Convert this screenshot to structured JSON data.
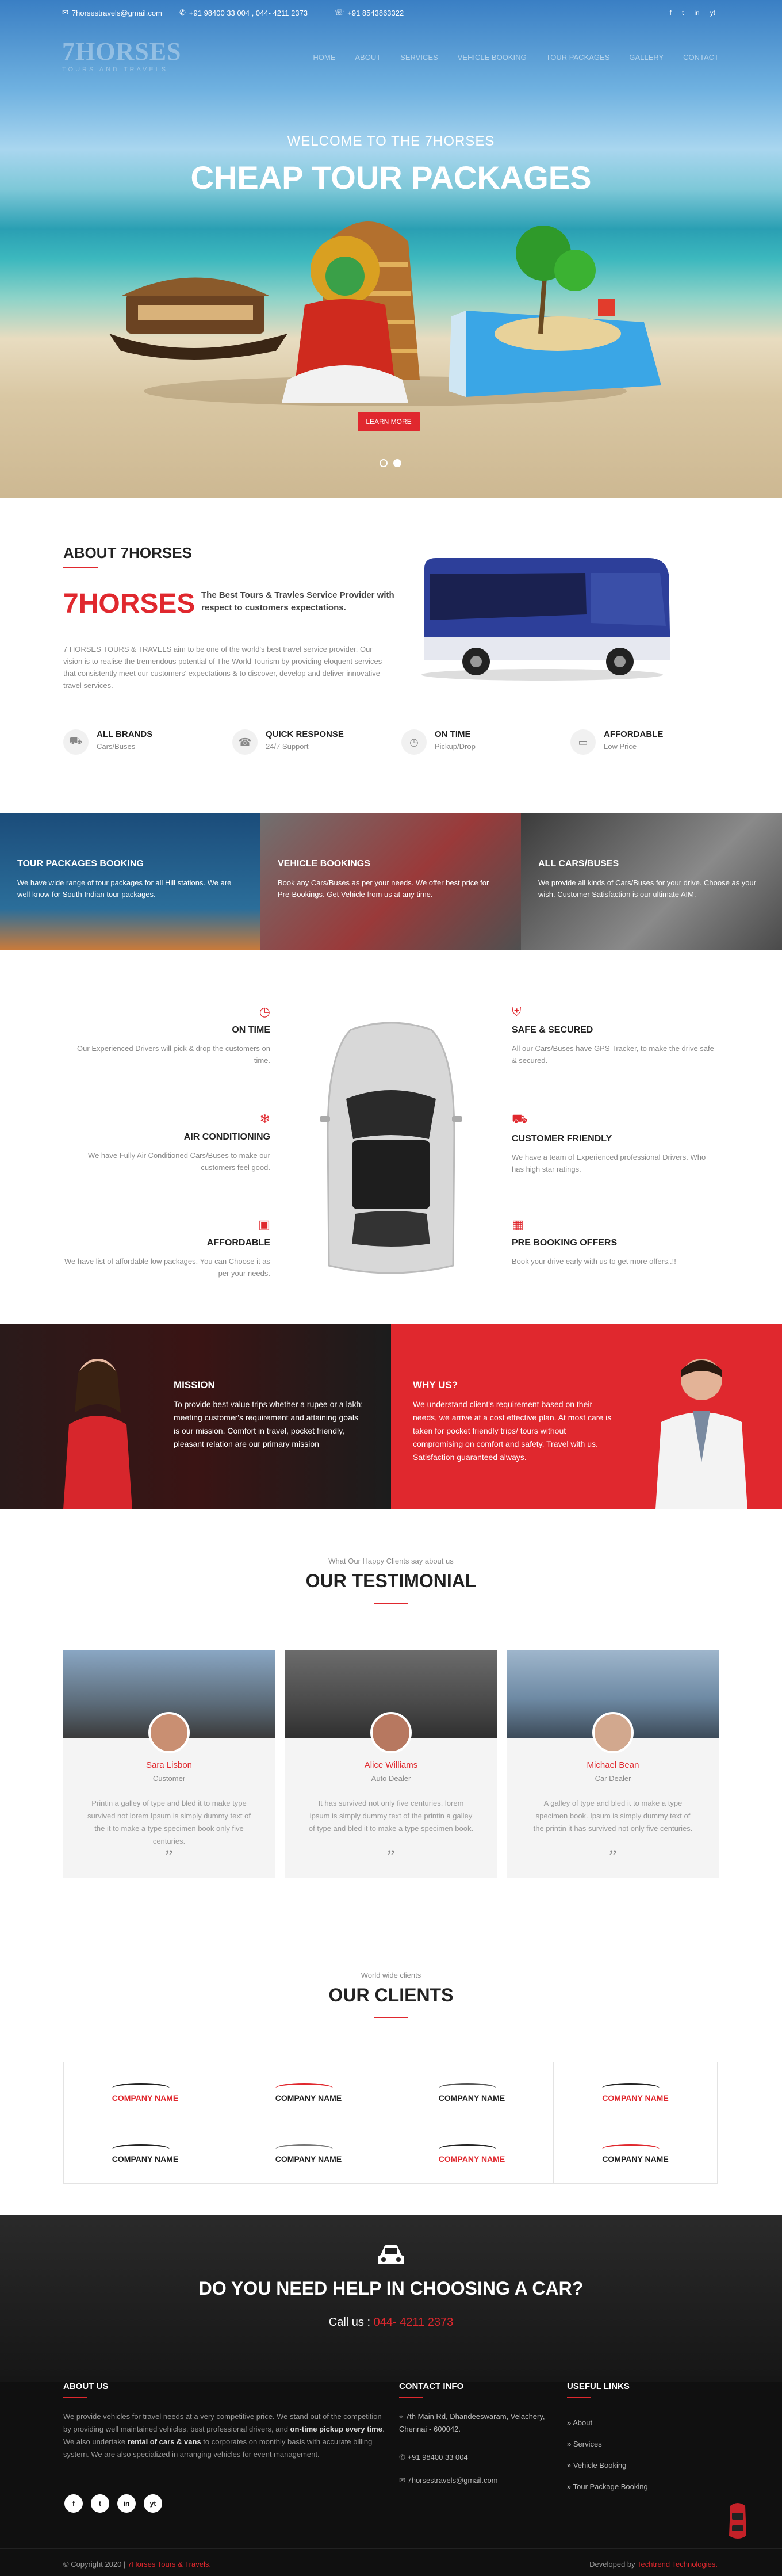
{
  "topbar": {
    "email": "7horsestravels@gmail.com",
    "phones": "+91 98400 33 004 , 044- 4211 2373",
    "mobile": "+91 8543863322",
    "social": [
      "f",
      "t",
      "in",
      "yt"
    ]
  },
  "logo": {
    "name": "7HORSES",
    "tagline": "TOURS AND TRAVELS"
  },
  "nav": [
    "HOME",
    "ABOUT",
    "SERVICES",
    "VEHICLE BOOKING",
    "TOUR PACKAGES",
    "GALLERY",
    "CONTACT"
  ],
  "hero": {
    "welcome": "WELCOME TO THE 7HORSES",
    "title": "CHEAP TOUR PACKAGES",
    "button": "LEARN MORE"
  },
  "about": {
    "heading": "ABOUT 7HORSES",
    "brand": "7HORSES",
    "tagline": "The Best Tours & Travles Service Provider with respect to customers expectations.",
    "body": "7 HORSES TOURS & TRAVELS aim to be one of the world's best travel service provider. Our vision is to realise the tremendous potential of The World Tourism by providing eloquent services that consistently meet our customers' expectations & to discover, develop and deliver innovative travel services.",
    "features": [
      {
        "title": "ALL BRANDS",
        "sub": "Cars/Buses",
        "icon": "car-icon"
      },
      {
        "title": "QUICK RESPONSE",
        "sub": "24/7 Support",
        "icon": "support-icon"
      },
      {
        "title": "ON TIME",
        "sub": "Pickup/Drop",
        "icon": "clock-icon"
      },
      {
        "title": "AFFORDABLE",
        "sub": "Low Price",
        "icon": "price-icon"
      }
    ]
  },
  "banners": [
    {
      "title": "TOUR PACKAGES BOOKING",
      "text": "We have wide range of tour packages for all Hill stations. We are well know for South Indian tour packages."
    },
    {
      "title": "VEHICLE BOOKINGS",
      "text": "Book any Cars/Buses as per your needs. We offer best price for Pre-Bookings. Get Vehicle from us at any time."
    },
    {
      "title": "ALL CARS/BUSES",
      "text": "We provide all kinds of Cars/Buses for your drive. Choose as your wish. Customer Satisfaction is our ultimate AIM."
    }
  ],
  "services": [
    {
      "title": "ON TIME",
      "text": "Our Experienced Drivers will pick & drop the customers on time."
    },
    {
      "title": "AIR CONDITIONING",
      "text": "We have Fully Air Conditioned Cars/Buses to make our customers feel good."
    },
    {
      "title": "AFFORDABLE",
      "text": "We have list of affordable low packages. You can Choose it as per your needs."
    },
    {
      "title": "SAFE & SECURED",
      "text": "All our Cars/Buses have GPS Tracker, to make the drive safe & secured."
    },
    {
      "title": "CUSTOMER FRIENDLY",
      "text": "We have a team of Experienced professional Drivers. Who has high star ratings."
    },
    {
      "title": "PRE BOOKING OFFERS",
      "text": "Book your drive early with us to get more offers..!!"
    }
  ],
  "mission": {
    "title": "MISSION",
    "text": "To provide best value trips whether a rupee or a lakh; meeting customer's requirement and attaining goals is our mission. Comfort in travel, pocket friendly, pleasant relation are our primary mission"
  },
  "whyus": {
    "title": "WHY US?",
    "text": "We understand client's requirement based on their needs, we arrive at a cost effective plan. At most care is taken for pocket friendly trips/ tours without compromising on comfort and safety. Travel with us. Satisfaction guaranteed always."
  },
  "testimonial": {
    "kicker": "What Our Happy Clients say about us",
    "heading": "OUR TESTIMONIAL",
    "items": [
      {
        "name": "Sara Lisbon",
        "role": "Customer",
        "text": "Printin a galley of type and bled it to make type survived not lorem Ipsum is simply dummy text of the it to make a type specimen book only five centuries."
      },
      {
        "name": "Alice Williams",
        "role": "Auto Dealer",
        "text": "It has survived not only five centuries. lorem ipsum is simply dummy text of the printin a galley of type and bled it to make a type specimen book."
      },
      {
        "name": "Michael Bean",
        "role": "Car Dealer",
        "text": "A galley of type and bled it to make a type specimen book. Ipsum is simply dummy text of the printin it has survived not only five centuries."
      }
    ],
    "quote": "”"
  },
  "clients": {
    "kicker": "World wide clients",
    "heading": "OUR CLIENTS",
    "logo_text": "COMPANY NAME"
  },
  "cta": {
    "heading": "DO YOU NEED HELP IN CHOOSING A CAR?",
    "call_label": "Call us :",
    "call_number": "044- 4211 2373"
  },
  "footer": {
    "about_heading": "ABOUT US",
    "about_text_1": "We provide vehicles for travel needs at a very competitive price. We stand out of the competition by providing well maintained vehicles, best professional drivers, and ",
    "about_bold_1": "on-time pickup every time",
    "about_text_2": ". We also undertake ",
    "about_bold_2": "rental of cars & vans",
    "about_text_3": " to corporates on monthly basis with accurate billing system. We are also specialized in arranging vehicles for event management.",
    "social": [
      "f",
      "t",
      "in",
      "yt"
    ],
    "contact_heading": "CONTACT INFO",
    "address": "7th Main Rd, Dhandeeswaram, Velachery, Chennai - 600042.",
    "phone": "+91 98400 33 004",
    "email": "7horsestravels@gmail.com",
    "links_heading": "USEFUL LINKS",
    "links": [
      "About",
      "Services",
      "Vehicle Booking",
      "Tour Package Booking"
    ],
    "copyright": "© Copyright 2020 |",
    "copyright_brand": "7Horses Tours & Travels.",
    "developed": "Developed by",
    "developer": "Techtrend Technologies."
  },
  "colors": {
    "accent": "#e0282e",
    "dark": "#101010"
  }
}
